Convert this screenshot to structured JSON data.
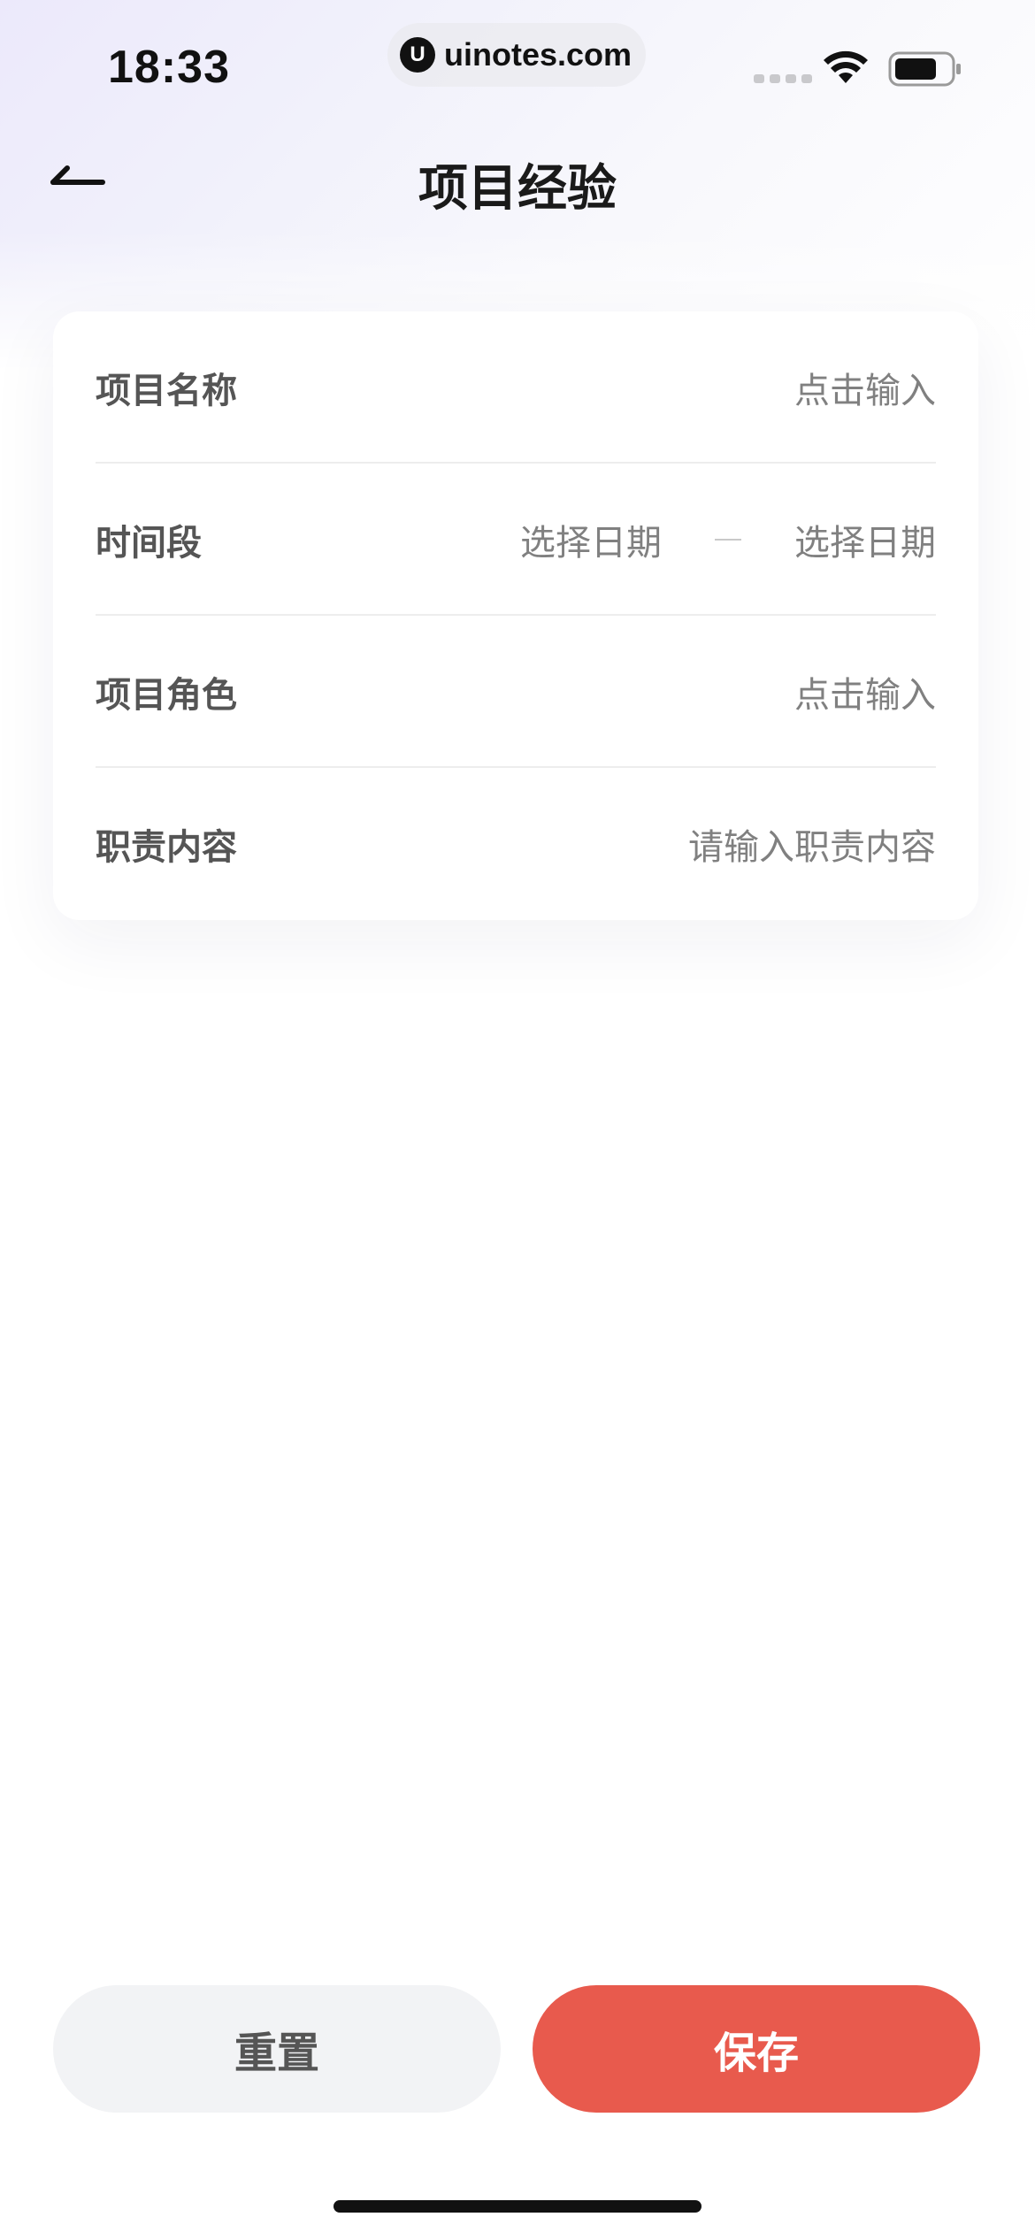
{
  "status_bar": {
    "time": "18:33",
    "url": "uinotes.com",
    "logo_letter": "U"
  },
  "nav": {
    "title": "项目经验"
  },
  "form": {
    "rows": [
      {
        "label": "项目名称",
        "value": "点击输入"
      },
      {
        "label": "时间段",
        "start": "选择日期",
        "end": "选择日期"
      },
      {
        "label": "项目角色",
        "value": "点击输入"
      },
      {
        "label": "职责内容",
        "value": "请输入职责内容"
      }
    ]
  },
  "actions": {
    "reset_label": "重置",
    "save_label": "保存"
  },
  "colors": {
    "accent": "#e85a4d",
    "reset_bg": "#f2f3f5"
  }
}
